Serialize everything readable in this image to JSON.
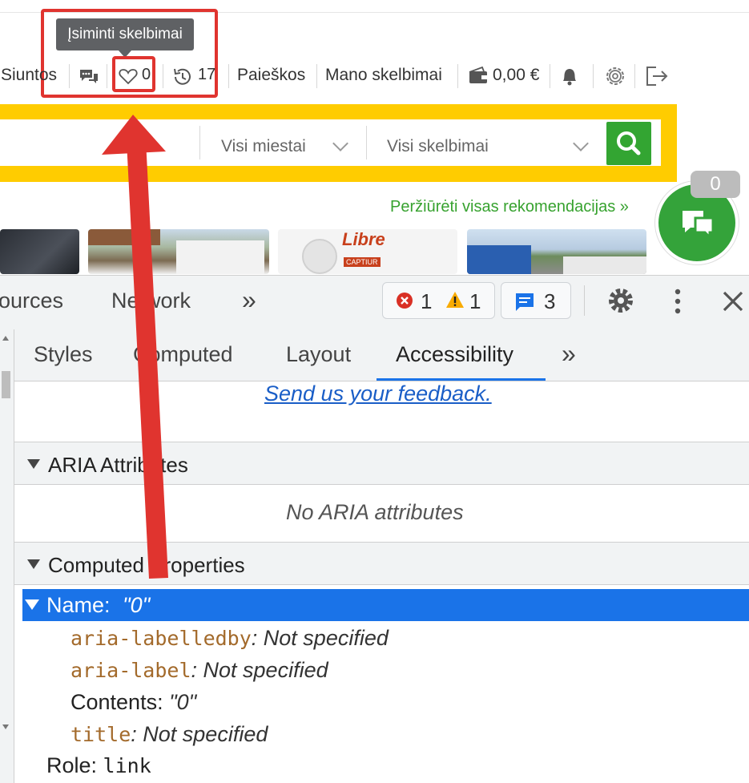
{
  "site": {
    "nav": {
      "siuntos": "Siuntos",
      "messages_icon": "chat-bubbles-icon",
      "favorites_count": "0",
      "history_count": "17",
      "paieskos": "Paieškos",
      "mano_skelbimai": "Mano skelbimai",
      "wallet_amount": "0,00 €"
    },
    "tooltip": "Įsiminti skelbimai",
    "search": {
      "city_select": "Visi miestai",
      "category_select": "Visi skelbimai"
    },
    "recommendations_link": "Peržiūrėti visas rekomendacijas »",
    "chat_count": "0",
    "thumb_text": {
      "title": "Libre",
      "caption": "CAPTIUR"
    },
    "colors": {
      "yellow": "#ffcc00",
      "green": "#33a532",
      "red_annotation": "#e0342f"
    }
  },
  "devtools": {
    "top_tabs": {
      "sources": "ources",
      "network": "Network",
      "more": "»"
    },
    "errors": "1",
    "warnings": "1",
    "messages": "3",
    "sub_tabs": {
      "styles": "Styles",
      "computed": "Computed",
      "layout": "Layout",
      "accessibility": "Accessibility",
      "more": "»"
    },
    "feedback_link": "Send us your feedback.",
    "aria_section": {
      "title": "ARIA Attributes",
      "empty": "No ARIA attributes"
    },
    "computed_section": {
      "title": "Computed Properties",
      "name_label": "Name: ",
      "name_value": "\"0\"",
      "labelledby_key": "aria-labelledby",
      "labelledby_val": ": Not specified",
      "label_key": "aria-label",
      "label_val": ": Not specified",
      "contents_label": "Contents: ",
      "contents_val": "\"0\"",
      "title_key": "title",
      "title_val": ": Not specified",
      "role_label": "Role: ",
      "role_val": "link"
    },
    "colors": {
      "selected_row": "#1a73e8",
      "panel_bg": "#f1f3f4"
    }
  }
}
